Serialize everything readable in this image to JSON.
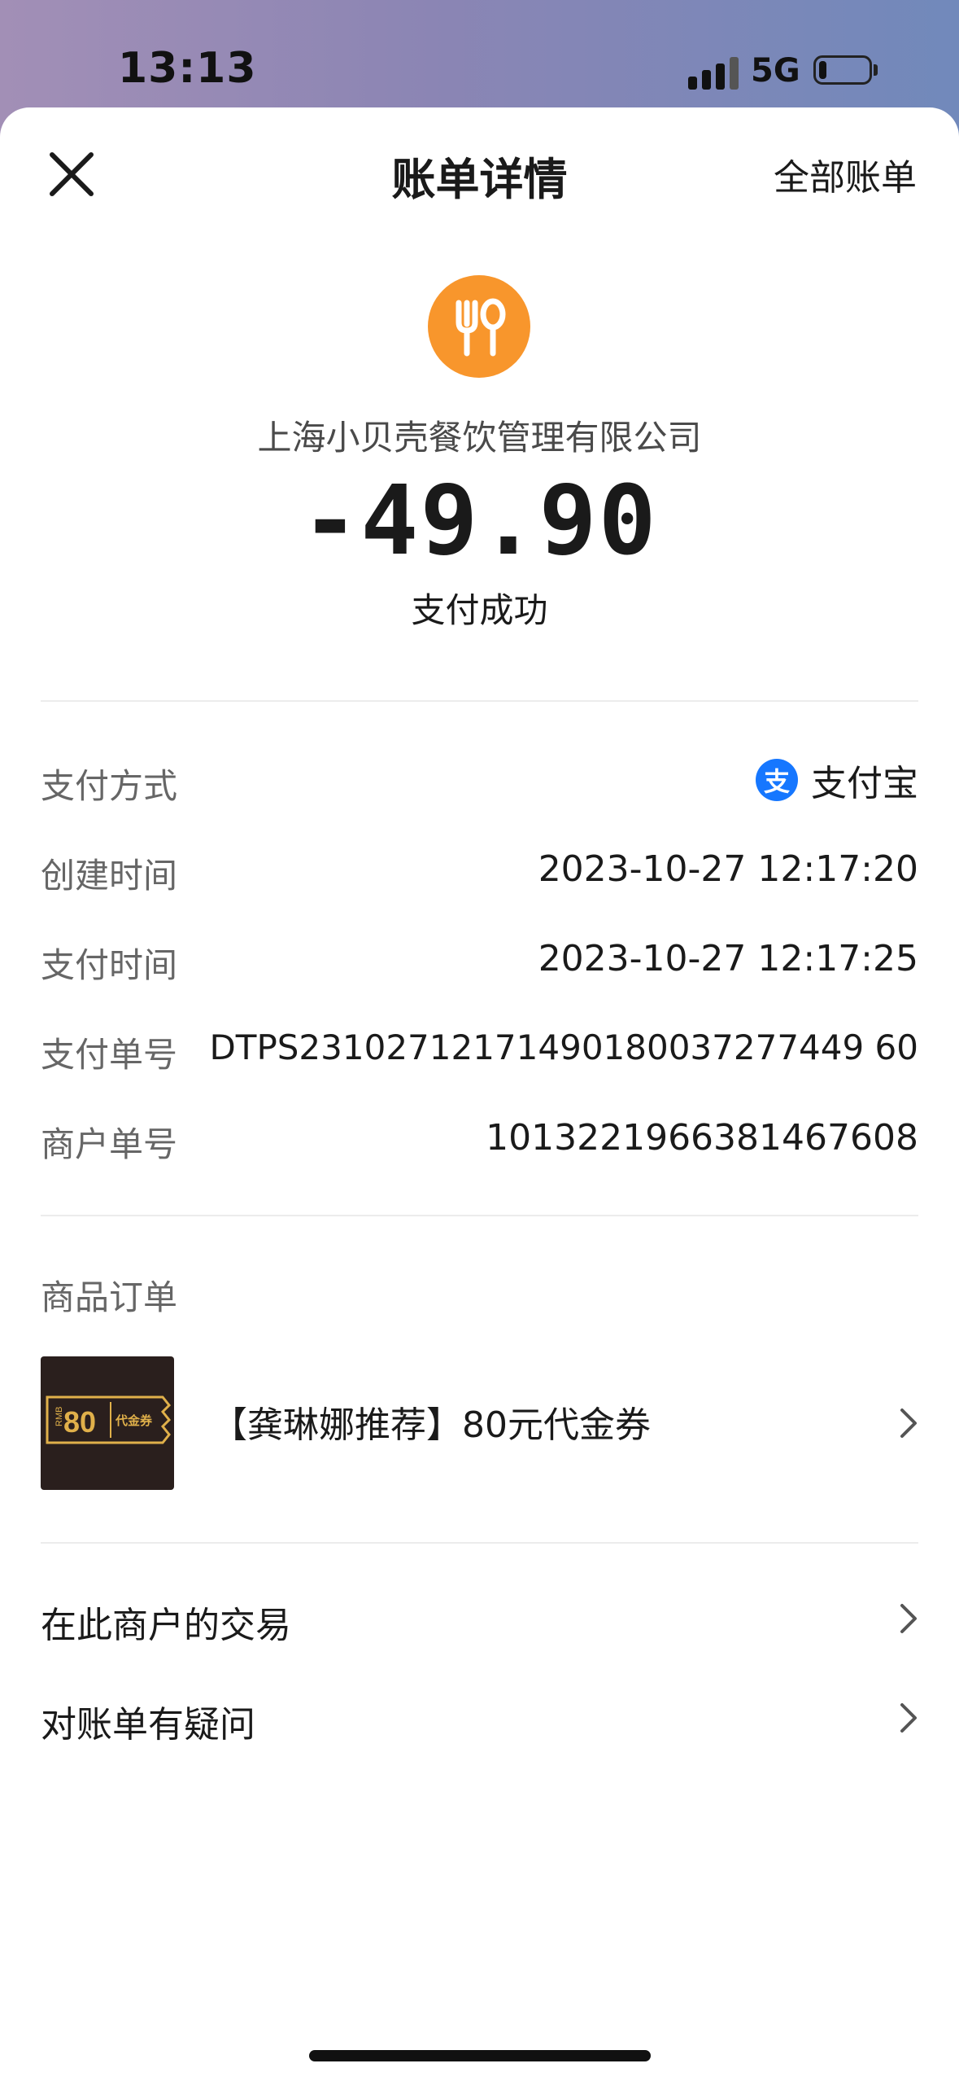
{
  "status_bar": {
    "time": "13:13",
    "network": "5G",
    "battery_level_pct": 15
  },
  "header": {
    "title": "账单详情",
    "all_bills_label": "全部账单",
    "close_icon": "close-icon"
  },
  "summary": {
    "merchant_icon": "fork-spoon-icon",
    "merchant_name": "上海小贝壳餐饮管理有限公司",
    "amount": "-49.90",
    "status": "支付成功"
  },
  "details": {
    "payment_method": {
      "label": "支付方式",
      "value": "支付宝",
      "icon": "alipay-icon",
      "icon_glyph": "支"
    },
    "created_time": {
      "label": "创建时间",
      "value": "2023-10-27 12:17:20"
    },
    "paid_time": {
      "label": "支付时间",
      "value": "2023-10-27 12:17:25"
    },
    "payment_no": {
      "label": "支付单号",
      "value": "DTPS23102712171490180037277449 60"
    },
    "merchant_no": {
      "label": "商户单号",
      "value": "1013221966381467608"
    }
  },
  "order": {
    "section_title": "商品订单",
    "item_title": "【龚琳娜推荐】80元代金券",
    "thumb": {
      "rmb": "RMB",
      "amount": "80",
      "label": "代金券"
    }
  },
  "links": [
    {
      "label": "在此商户的交易"
    },
    {
      "label": "对账单有疑问"
    }
  ],
  "colors": {
    "accent_orange": "#f8962c",
    "alipay_blue": "#1677ff",
    "voucher_gold": "#e0b04a"
  }
}
